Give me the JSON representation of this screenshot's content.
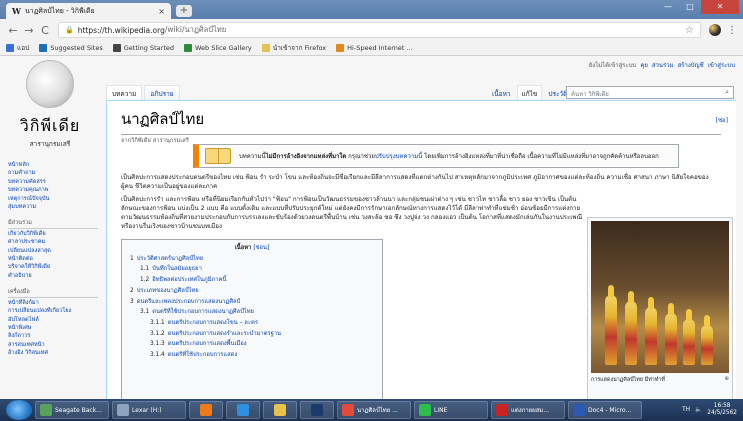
{
  "browser": {
    "tab_title": "นาฏศิลป์ไทย - วิกิพีเดีย",
    "tab_favicon": "W",
    "tab_close": "×",
    "new_tab": "+",
    "url_host": "https://th.wikipedia.org",
    "url_path": "/wiki/นาฏศิลป์ไทย",
    "back": "←",
    "forward": "→",
    "reload": "C",
    "star": "☆",
    "menu": "⋮",
    "win_min": "—",
    "win_max": "□",
    "win_close": "✕"
  },
  "bookmarks": [
    {
      "label": "แอป",
      "icon": "apps-icon",
      "color": "#3a6fd8"
    },
    {
      "label": "Suggested Sites",
      "icon": "ie-icon",
      "color": "#1d6fbd"
    },
    {
      "label": "Getting Started",
      "icon": "firefox-icon",
      "color": "#444444"
    },
    {
      "label": "Web Slice Gallery",
      "icon": "slice-icon",
      "color": "#2e8b3a"
    },
    {
      "label": "นำเข้าจาก Firefox",
      "icon": "folder-icon",
      "color": "#e7c34e"
    },
    {
      "label": "Hi-Speed Internet ...",
      "icon": "msn-icon",
      "color": "#e28a1a"
    }
  ],
  "personal": {
    "not_logged": "ยังไม่ได้เข้าสู่ระบบ",
    "talk": "คุย",
    "contrib": "ส่วนร่วม",
    "create": "สร้างบัญชี",
    "login": "เข้าสู่ระบบ"
  },
  "logo": {
    "name": "วิกิพีเดีย",
    "tagline": "สารานุกรมเสรี"
  },
  "sidebar": {
    "main": [
      "หน้าหลัก",
      "ถามคำถาม",
      "บทความคัดสรร",
      "บทความคุณภาพ",
      "เหตุการณ์ปัจจุบัน",
      "สุ่มบทความ"
    ],
    "interact_heading": "มีส่วนร่วม",
    "interact": [
      "เกี่ยวกับวิกิพีเดีย",
      "ศาลาประชาคม",
      "เปลี่ยนแปลงล่าสุด",
      "หน้าติดต่อ",
      "บริจาคให้วิกิพีเดีย",
      "คำอธิบาย"
    ],
    "tools_heading": "เครื่องมือ",
    "tools": [
      "หน้าที่ลิงก์มา",
      "การเปลี่ยนแปลงที่เกี่ยวโยง",
      "อัปโหลดไฟล์",
      "หน้าพิเศษ",
      "ลิงก์ถาวร",
      "สารสนเทศหน้า",
      "อ้างอิง วิกิสนเทศ"
    ]
  },
  "ns_tabs": {
    "article": "บทความ",
    "discussion": "อภิปราย"
  },
  "view_tabs": {
    "read": "เนื้อหา",
    "edit": "แก้ไข",
    "history": "ประวัติ",
    "more": "▾"
  },
  "search": {
    "placeholder": "ค้นหา วิกิพีเดีย",
    "icon": "⌕"
  },
  "article": {
    "title": "นาฏศิลป์ไทย",
    "edit": "[ซ่อ]",
    "subtitle": "จากวิกิพีเดีย สารานุกรมเสรี",
    "ambox_pre": "บทความนี้",
    "ambox_bold": "ไม่มีการอ้างอิงจากแหล่งที่มาใด",
    "ambox_mid": " กรุณาช่วย",
    "ambox_link": "ปรับปรุงบทความนี้",
    "ambox_post": " โดยเพิ่มการอ้างอิงแหล่งที่มาที่น่าเชื่อถือ เนื้อความที่ไม่มีแหล่งที่มาอาจถูกคัดค้านหรือลบออก",
    "p1": "เป็นศิลปะการแสดงประกอบดนตรีของไทย เช่น ฟ้อน รำ ระบำ โขน และท้องถิ่นจะมีชื่อเรียกและมีลีลาการแสดงที่แตกต่างกันไป สาเหตุหลักมาจากภูมิประเทศ ภูมิอากาศของแต่ละท้องถิ่น ความเชื่อ ศาสนา ภาษา นิสัยใจคอของผู้คน ชีวิตความเป็นอยู่ของแต่ละภาค",
    "p2": "เป็นศิลปะการรำ และการฟ้อน หรือที่นิยมเรียกกันทั่วไปว่า \"ฟ้อน\" การฟ้อนเป็นวัฒนธรรมของชาวล้านนา และกลุ่มชนเผ่าต่าง ๆ เช่น ชาวไท ชาวลื้อ ชาว ยอง ชาวเขิน เป็นต้น ลักษณะของการฟ้อน แบ่งเป็น 2 แบบ คือ แบบดั้งเดิม และแบบที่ปรับประยุกต์ใหม่ แต่ยังคงมีการรักษาเอกลักษณ์ทางการแสดงไว้ได้ มีลีลาท่าทำที่แช่มช้า อ่อนช้อยมีการแต่งกายตามวัฒนธรรมท้องถิ่นที่สวยงามประกอบกับการบรรเลงและขับร้องด้วยวงดนตรีพื้นบ้าน เช่น วงสะล้อ ซอ ซึง วงปูจ่ง วง กลองแอว เป็นต้น โอกาสที่แสดงมักเล่นกันในงานประเพณีหรืองานรื่นเริงของชาวบ้านชนบทเมือง"
  },
  "toc": {
    "title": "เนื้อหา",
    "toggle": "[ซ่อน]",
    "items": [
      {
        "num": "1",
        "text": "ประวัติศาสตร์นาฏศิลป์ไทย",
        "level": 1
      },
      {
        "num": "1.1",
        "text": "บันทึกในสมัยอยุธยา",
        "level": 2
      },
      {
        "num": "1.2",
        "text": "อิทธิพลต่อประเทศในภูมิภาคนี้",
        "level": 2
      },
      {
        "num": "2",
        "text": "ประเภทของนาฏศิลป์ไทย",
        "level": 1
      },
      {
        "num": "3",
        "text": "ดนตรีและเพลงประกอบการแสดงนาฏศิลป์",
        "level": 1
      },
      {
        "num": "3.1",
        "text": "ดนตรีที่ใช้ประกอบการแสดงนาฏศิลป์ไทย",
        "level": 2
      },
      {
        "num": "3.1.1",
        "text": "ดนตรีประกอบการแสดงโขน – ละคร",
        "level": 3
      },
      {
        "num": "3.1.2",
        "text": "ดนตรีประกอบการแสดงรำและระบำมาตรฐาน",
        "level": 3
      },
      {
        "num": "3.1.3",
        "text": "ดนตรีประกอบการแสดงพื้นเมือง",
        "level": 3
      },
      {
        "num": "3.1.4",
        "text": "ดนตรีที่ใช้ประกอบการแสดง",
        "level": 3
      }
    ]
  },
  "thumb": {
    "caption": "การแสดงนาฏศิลป์ไทย มีท่าทำที่",
    "mag": "⊕"
  },
  "taskbar": [
    {
      "label": "Seagate Back...",
      "icon": "seagate-icon",
      "color": "#5aa25a"
    },
    {
      "label": "Lexar (H:)",
      "icon": "drive-icon",
      "color": "#8ea3bd"
    },
    {
      "label": "",
      "icon": "media-player-icon",
      "color": "#f07a1a"
    },
    {
      "label": "",
      "icon": "ie-icon",
      "color": "#2e8fe0"
    },
    {
      "label": "",
      "icon": "folder-icon",
      "color": "#e7c34e"
    },
    {
      "label": "",
      "icon": "photoshop-icon",
      "color": "#1b3a6b"
    },
    {
      "label": "นาฏศิลป์ไทย ...",
      "icon": "chrome-icon",
      "color": "#e24b3b"
    },
    {
      "label": "LINE",
      "icon": "line-icon",
      "color": "#2bbf4a"
    },
    {
      "label": "แต่งกายผสม...",
      "icon": "acrobat-icon",
      "color": "#c92222"
    },
    {
      "label": "Doc4 - Micro...",
      "icon": "word-icon",
      "color": "#2a5ab4"
    }
  ],
  "tray": {
    "lang": "TH",
    "time": "16:58",
    "date": "24/5/2562"
  }
}
